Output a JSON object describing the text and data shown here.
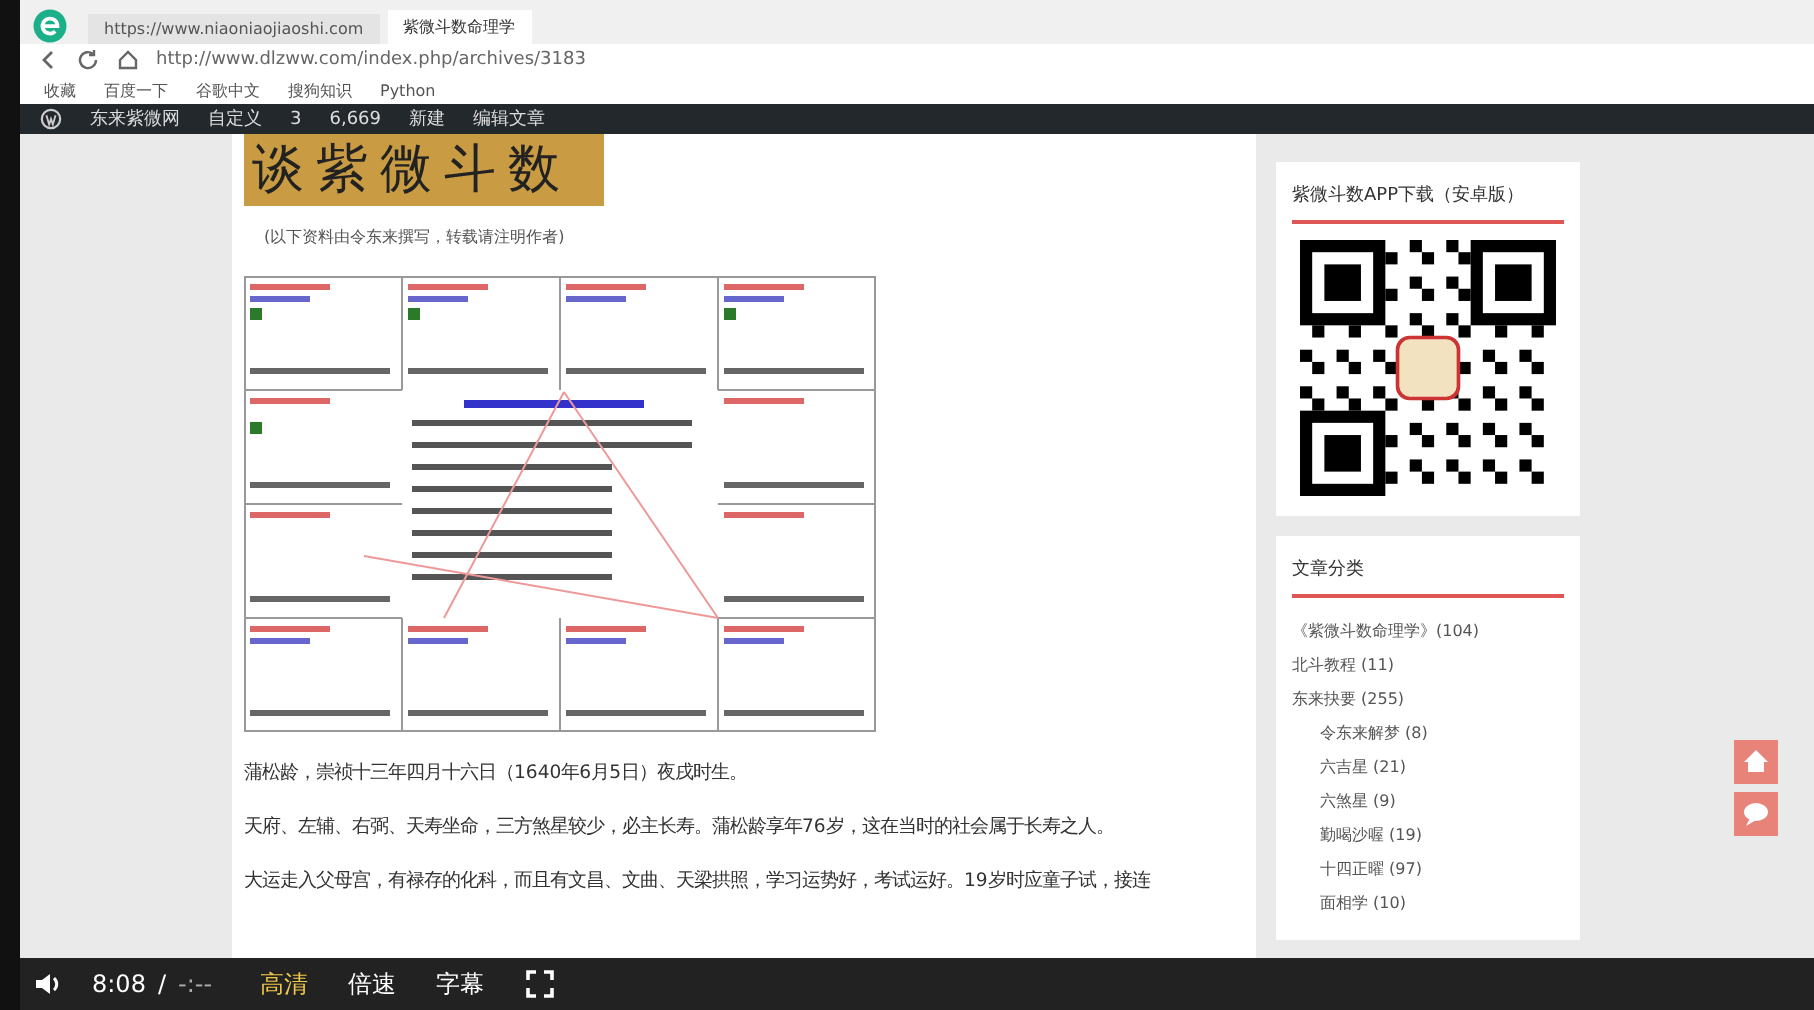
{
  "browser": {
    "tabs": [
      {
        "label": "https://www.niaoniaojiaoshi.com",
        "selected": false
      },
      {
        "label": "紫微斗数命理学",
        "selected": true
      }
    ],
    "address": "http://www.dlzww.com/index.php/archives/3183",
    "bookmarks": [
      "收藏",
      "百度一下",
      "谷歌中文",
      "搜狗知识",
      "Python"
    ]
  },
  "admin_bar": {
    "site": "东来紫微网",
    "customize": "自定义",
    "updates": "3",
    "comments": "6,669",
    "new": "新建",
    "edit": "编辑文章"
  },
  "article": {
    "banner": "谈紫微斗数",
    "note": "(以下资料由令东来撰写，转载请注明作者)",
    "paragraphs": [
      "蒲松龄，崇祯十三年四月十六日（1640年6月5日）夜戌时生。",
      "天府、左辅、右弼、天寿坐命，三方煞星较少，必主长寿。蒲松龄享年76岁，这在当时的社会属于长寿之人。",
      "大运走入父母宫，有禄存的化科，而且有文昌、文曲、天梁拱照，学习运势好，考试运好。19岁时应童子试，接连"
    ]
  },
  "sidebar": {
    "app_title": "紫微斗数APP下载（安卓版）",
    "categories_title": "文章分类",
    "categories": [
      {
        "label": "《紫微斗数命理学》(104)"
      },
      {
        "label": "北斗教程 (11)"
      },
      {
        "label": "东来抉要 (255)",
        "children": [
          {
            "label": "令东来解梦 (8)"
          },
          {
            "label": "六吉星 (21)"
          },
          {
            "label": "六煞星 (9)"
          },
          {
            "label": "勤喝沙喔 (19)"
          },
          {
            "label": "十四正曜 (97)"
          },
          {
            "label": "面相学 (10)"
          }
        ]
      }
    ]
  },
  "player": {
    "time": "8:08",
    "separator": "/",
    "duration": "-:--",
    "controls": [
      {
        "label": "高清",
        "selected": true
      },
      {
        "label": "倍速",
        "selected": false
      },
      {
        "label": "字幕",
        "selected": false
      }
    ]
  }
}
